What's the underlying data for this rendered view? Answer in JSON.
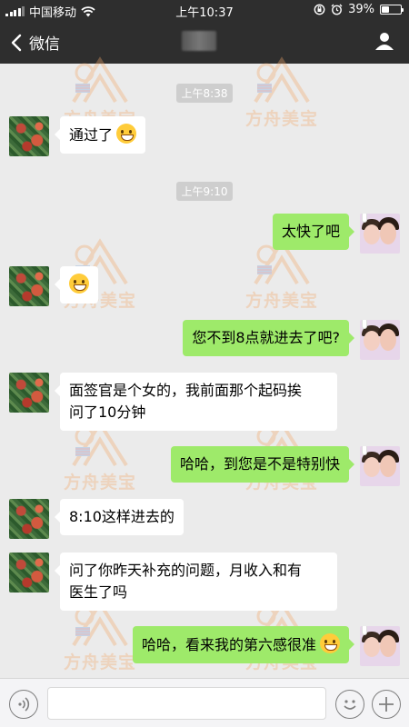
{
  "status_bar": {
    "carrier": "中国移动",
    "time": "上午10:37",
    "battery_text": "39%",
    "battery_level": 0.39,
    "icons": [
      "signal-icon",
      "wifi-icon",
      "orientation-lock-icon",
      "alarm-icon",
      "battery-icon"
    ]
  },
  "nav": {
    "back_label": "微信",
    "icons": [
      "back-chevron-icon",
      "contact-profile-icon"
    ]
  },
  "watermark": {
    "text": "方舟美宝"
  },
  "messages": [
    {
      "type": "timestamp",
      "text": "上午8:38"
    },
    {
      "type": "message",
      "side": "in",
      "text": "通过了",
      "emoji": "hugging-face-emoji"
    },
    {
      "type": "timestamp",
      "text": "上午9:10"
    },
    {
      "type": "message",
      "side": "out",
      "text": "太快了吧"
    },
    {
      "type": "message",
      "side": "in",
      "text": "",
      "emoji": "grinning-face-emoji"
    },
    {
      "type": "message",
      "side": "out",
      "text": "您不到8点就进去了吧?"
    },
    {
      "type": "message",
      "side": "in",
      "lines": [
        "面签官是个女的，我前面那个起码挨",
        "问了10分钟"
      ]
    },
    {
      "type": "message",
      "side": "out",
      "text": "哈哈，到您是不是特别快"
    },
    {
      "type": "message",
      "side": "in",
      "text": "8:10这样进去的"
    },
    {
      "type": "message",
      "side": "in",
      "lines": [
        "问了你昨天补充的问题，月收入和有",
        "医生了吗"
      ]
    },
    {
      "type": "message",
      "side": "out",
      "text": "哈哈，看来我的第六感很准",
      "emoji": "grinning-face-emoji"
    }
  ],
  "input_bar": {
    "icons": [
      "voice-input-icon",
      "emoji-picker-icon",
      "more-plus-icon"
    ],
    "value": ""
  },
  "colors": {
    "header_bg": "#2e2e2e",
    "chat_bg": "#ebebeb",
    "outgoing_bubble": "#9eea6a",
    "incoming_bubble": "#ffffff",
    "timestamp_bg": "#cecece",
    "watermark": "#f2a86a"
  }
}
